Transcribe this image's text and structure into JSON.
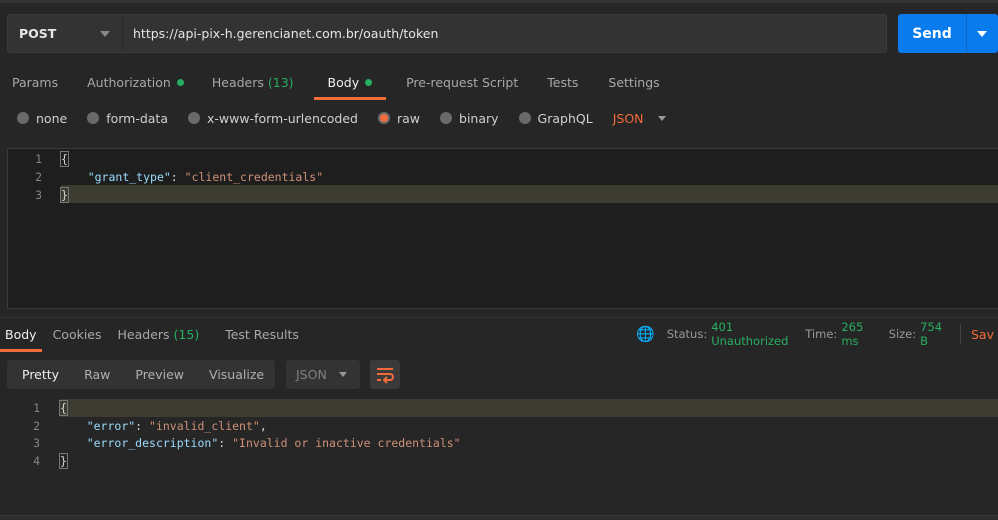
{
  "request": {
    "method": "POST",
    "url": "https://api-pix-h.gerencianet.com.br/oauth/token",
    "send_label": "Send"
  },
  "req_tabs": [
    {
      "label": "Params"
    },
    {
      "label": "Authorization",
      "dot": true
    },
    {
      "label": "Headers",
      "count": "(13)"
    },
    {
      "label": "Body",
      "dot": true,
      "active": true
    },
    {
      "label": "Pre-request Script"
    },
    {
      "label": "Tests"
    },
    {
      "label": "Settings"
    }
  ],
  "body_types": [
    "none",
    "form-data",
    "x-www-form-urlencoded",
    "raw",
    "binary",
    "GraphQL"
  ],
  "body_type_selected": "raw",
  "body_format": "JSON",
  "request_body": {
    "lines": [
      "1",
      "2",
      "3"
    ],
    "open": "{",
    "key": "\"grant_type\"",
    "value": "\"client_credentials\"",
    "close": "}"
  },
  "resp_tabs": [
    {
      "label": "Body",
      "active": true
    },
    {
      "label": "Cookies"
    },
    {
      "label": "Headers",
      "count": "(15)"
    },
    {
      "label": "Test Results"
    }
  ],
  "status": {
    "status_label": "Status:",
    "status_value": "401 Unauthorized",
    "time_label": "Time:",
    "time_value": "265 ms",
    "size_label": "Size:",
    "size_value": "754 B",
    "save_label": "Sav"
  },
  "view_modes": [
    "Pretty",
    "Raw",
    "Preview",
    "Visualize"
  ],
  "view_mode_selected": "Pretty",
  "response_format": "JSON",
  "response_body": {
    "lines": [
      "1",
      "2",
      "3",
      "4"
    ],
    "open": "{",
    "k1": "\"error\"",
    "v1": "\"invalid_client\"",
    "k2": "\"error_description\"",
    "v2": "\"Invalid or inactive credentials\"",
    "close": "}"
  },
  "colors": {
    "accent": "#f26b3a",
    "send": "#097bed",
    "success": "#27ae60"
  }
}
